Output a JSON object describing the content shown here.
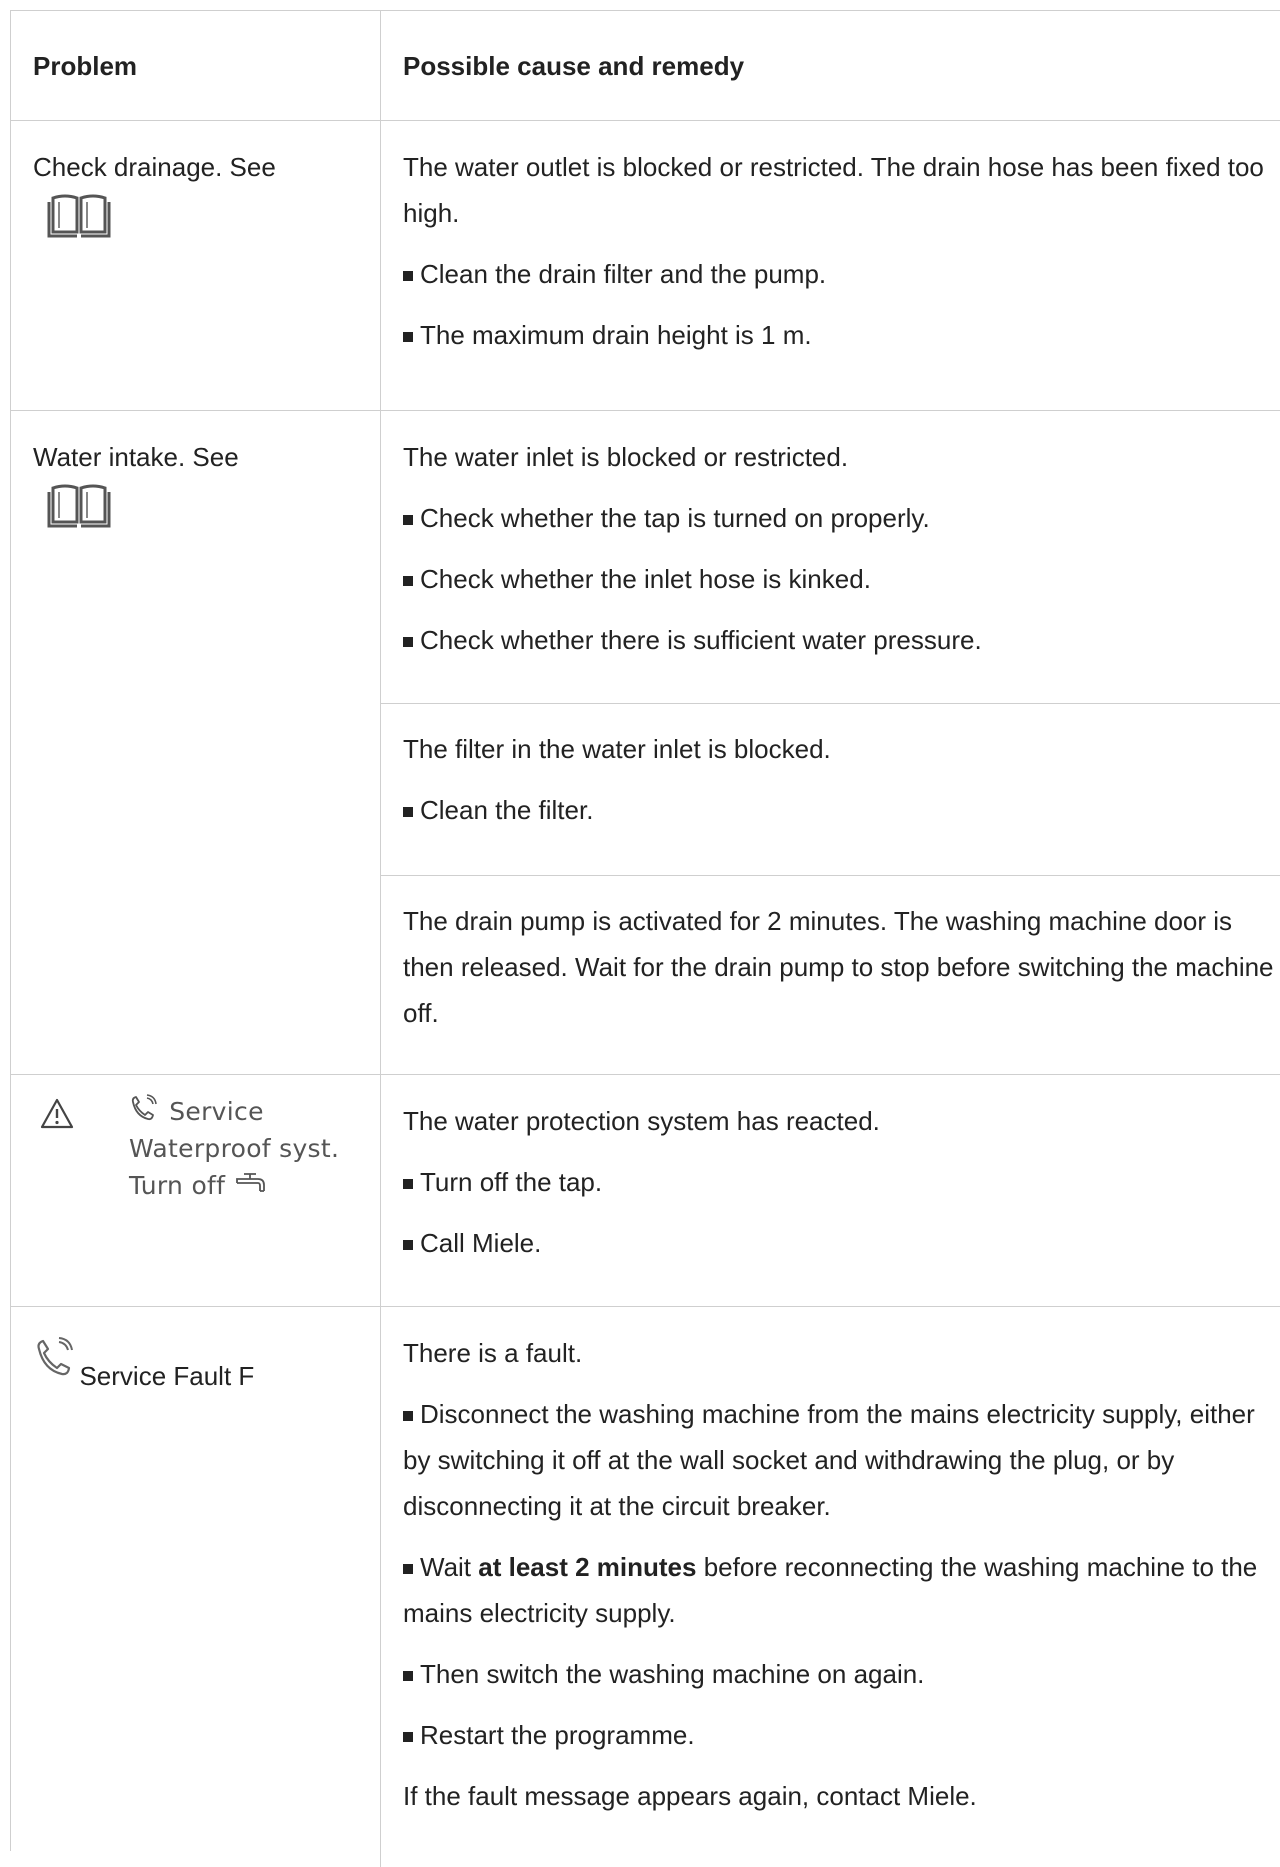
{
  "header": {
    "problem": "Problem",
    "remedy": "Possible cause and remedy"
  },
  "rows": [
    {
      "problem": "Check drainage. See",
      "problem_icon": "book-icon",
      "cause": "The water outlet is blocked or restricted. The drain hose has been fixed too high.",
      "bullets": [
        "Clean the drain filter and the pump.",
        "The maximum drain height is 1 m."
      ]
    },
    {
      "problem": "Water intake. See",
      "problem_icon": "book-icon",
      "sub": [
        {
          "cause": "The water inlet is blocked or restricted.",
          "bullets": [
            "Check whether the tap is turned on properly.",
            "Check whether the inlet hose is kinked.",
            "Check whether there is sufficient water pressure."
          ]
        },
        {
          "cause": "The filter in the water inlet is blocked.",
          "bullets": [
            "Clean the filter."
          ]
        },
        {
          "cause": "The drain pump is activated for 2 minutes. The washing machine door is then released. Wait for the drain pump to stop before switching the machine off."
        }
      ]
    },
    {
      "problem_icons": [
        "warning-triangle-icon",
        "phone-service-icon",
        "tap-icon"
      ],
      "lcd_lines": [
        "Service",
        "Waterproof syst.",
        "Turn off"
      ],
      "cause": "The water protection system has reacted.",
      "bullets": [
        "Turn off the tap.",
        "Call Miele."
      ]
    },
    {
      "problem_icon": "phone-service-icon",
      "problem": "Service Fault F",
      "cause": "There is a fault.",
      "b1": "Disconnect the washing machine from the mains electricity supply, either by switching it off at the wall socket and withdrawing the plug, or by disconnecting it at the circuit breaker.",
      "b2_pre": "Wait ",
      "b2_bold": "at least 2 minutes",
      "b2_post": " before reconnecting the washing machine to the mains electricity supply.",
      "b3": "Then switch the washing machine on again.",
      "b4": "Restart the programme.",
      "footer": "If the fault message appears again, contact Miele."
    }
  ]
}
